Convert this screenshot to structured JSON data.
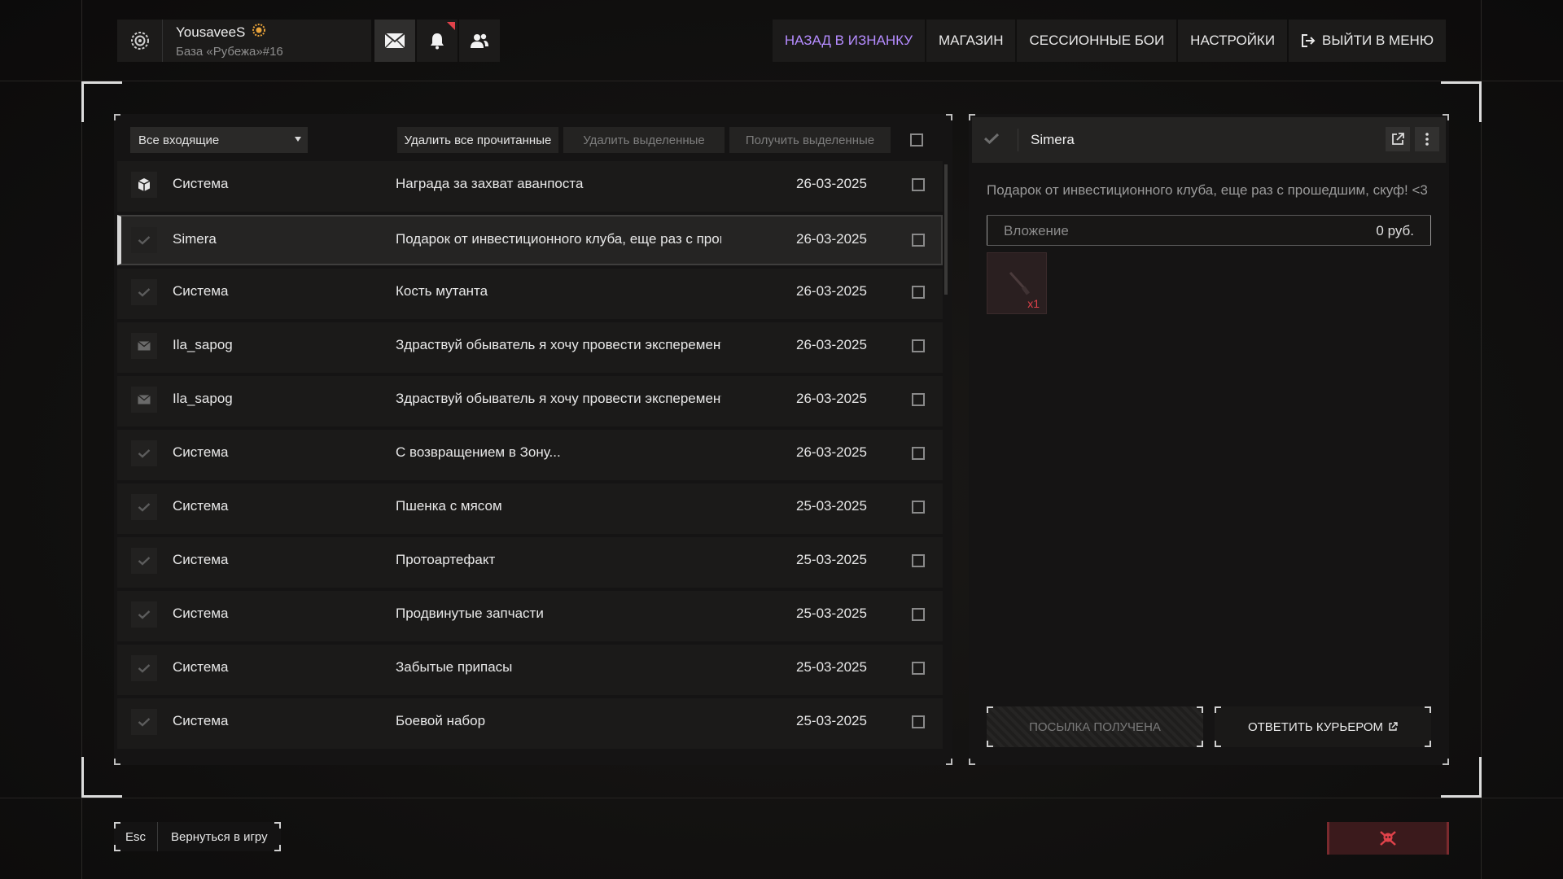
{
  "profile": {
    "username": "YousaveeS",
    "base": "База «Рубежа»#16",
    "emblem_icon": "faction-emblem-icon",
    "badge_icon": "gold-badge-icon"
  },
  "top_icons": [
    "mail-icon",
    "bell-icon",
    "friends-icon"
  ],
  "nav": {
    "back": "НАЗАД В ИЗНАНКУ",
    "shop": "МАГАЗИН",
    "session": "СЕССИОННЫЕ БОИ",
    "settings": "НАСТРОЙКИ",
    "exit": "ВЫЙТИ В МЕНЮ"
  },
  "toolbar": {
    "filter": "Все входящие",
    "delete_read": "Удалить все прочитанные",
    "delete_selected": "Удалить выделенные",
    "receive_selected": "Получить выделенные"
  },
  "messages": [
    {
      "icon": "package-icon",
      "sender": "Система",
      "subject": "Награда за захват аванпоста",
      "date": "26-03-2025"
    },
    {
      "icon": "check-icon",
      "sender": "Simera",
      "subject": "Подарок от инвестиционного клуба, еще раз с прошедшим, ск",
      "date": "26-03-2025"
    },
    {
      "icon": "check-icon",
      "sender": "Система",
      "subject": "Кость мутанта",
      "date": "26-03-2025"
    },
    {
      "icon": "envelope-icon",
      "sender": "Ila_sapog",
      "subject": "Здраствуй обыватель я хочу провести эксперемент заработат",
      "date": "26-03-2025"
    },
    {
      "icon": "envelope-icon",
      "sender": "Ila_sapog",
      "subject": "Здраствуй обыватель я хочу провести эксперемент заработат",
      "date": "26-03-2025"
    },
    {
      "icon": "check-icon",
      "sender": "Система",
      "subject": "С возвращением в Зону...",
      "date": "26-03-2025"
    },
    {
      "icon": "check-icon",
      "sender": "Система",
      "subject": "Пшенка с мясом",
      "date": "25-03-2025"
    },
    {
      "icon": "check-icon",
      "sender": "Система",
      "subject": "Протоартефакт",
      "date": "25-03-2025"
    },
    {
      "icon": "check-icon",
      "sender": "Система",
      "subject": "Продвинутые запчасти",
      "date": "25-03-2025"
    },
    {
      "icon": "check-icon",
      "sender": "Система",
      "subject": "Забытые припасы",
      "date": "25-03-2025"
    },
    {
      "icon": "check-icon",
      "sender": "Система",
      "subject": "Боевой набор",
      "date": "25-03-2025"
    }
  ],
  "selected_index": 1,
  "detail": {
    "from": "Simera",
    "body": "Подарок от инвестиционного клуба, еще раз с прошедшим, скуф! <3",
    "attachment_label": "Вложение",
    "attachment_value": "0 руб.",
    "item_qty": "x1",
    "received": "ПОСЫЛКА ПОЛУЧЕНА",
    "reply": "ОТВЕТИТЬ КУРЬЕРОМ"
  },
  "bottom": {
    "esc": "Esc",
    "back_to_game": "Вернуться в игру",
    "skull_icon": "skull-crossbones-icon"
  },
  "colors": {
    "accent": "#b58cff",
    "alert": "#e0424a"
  }
}
